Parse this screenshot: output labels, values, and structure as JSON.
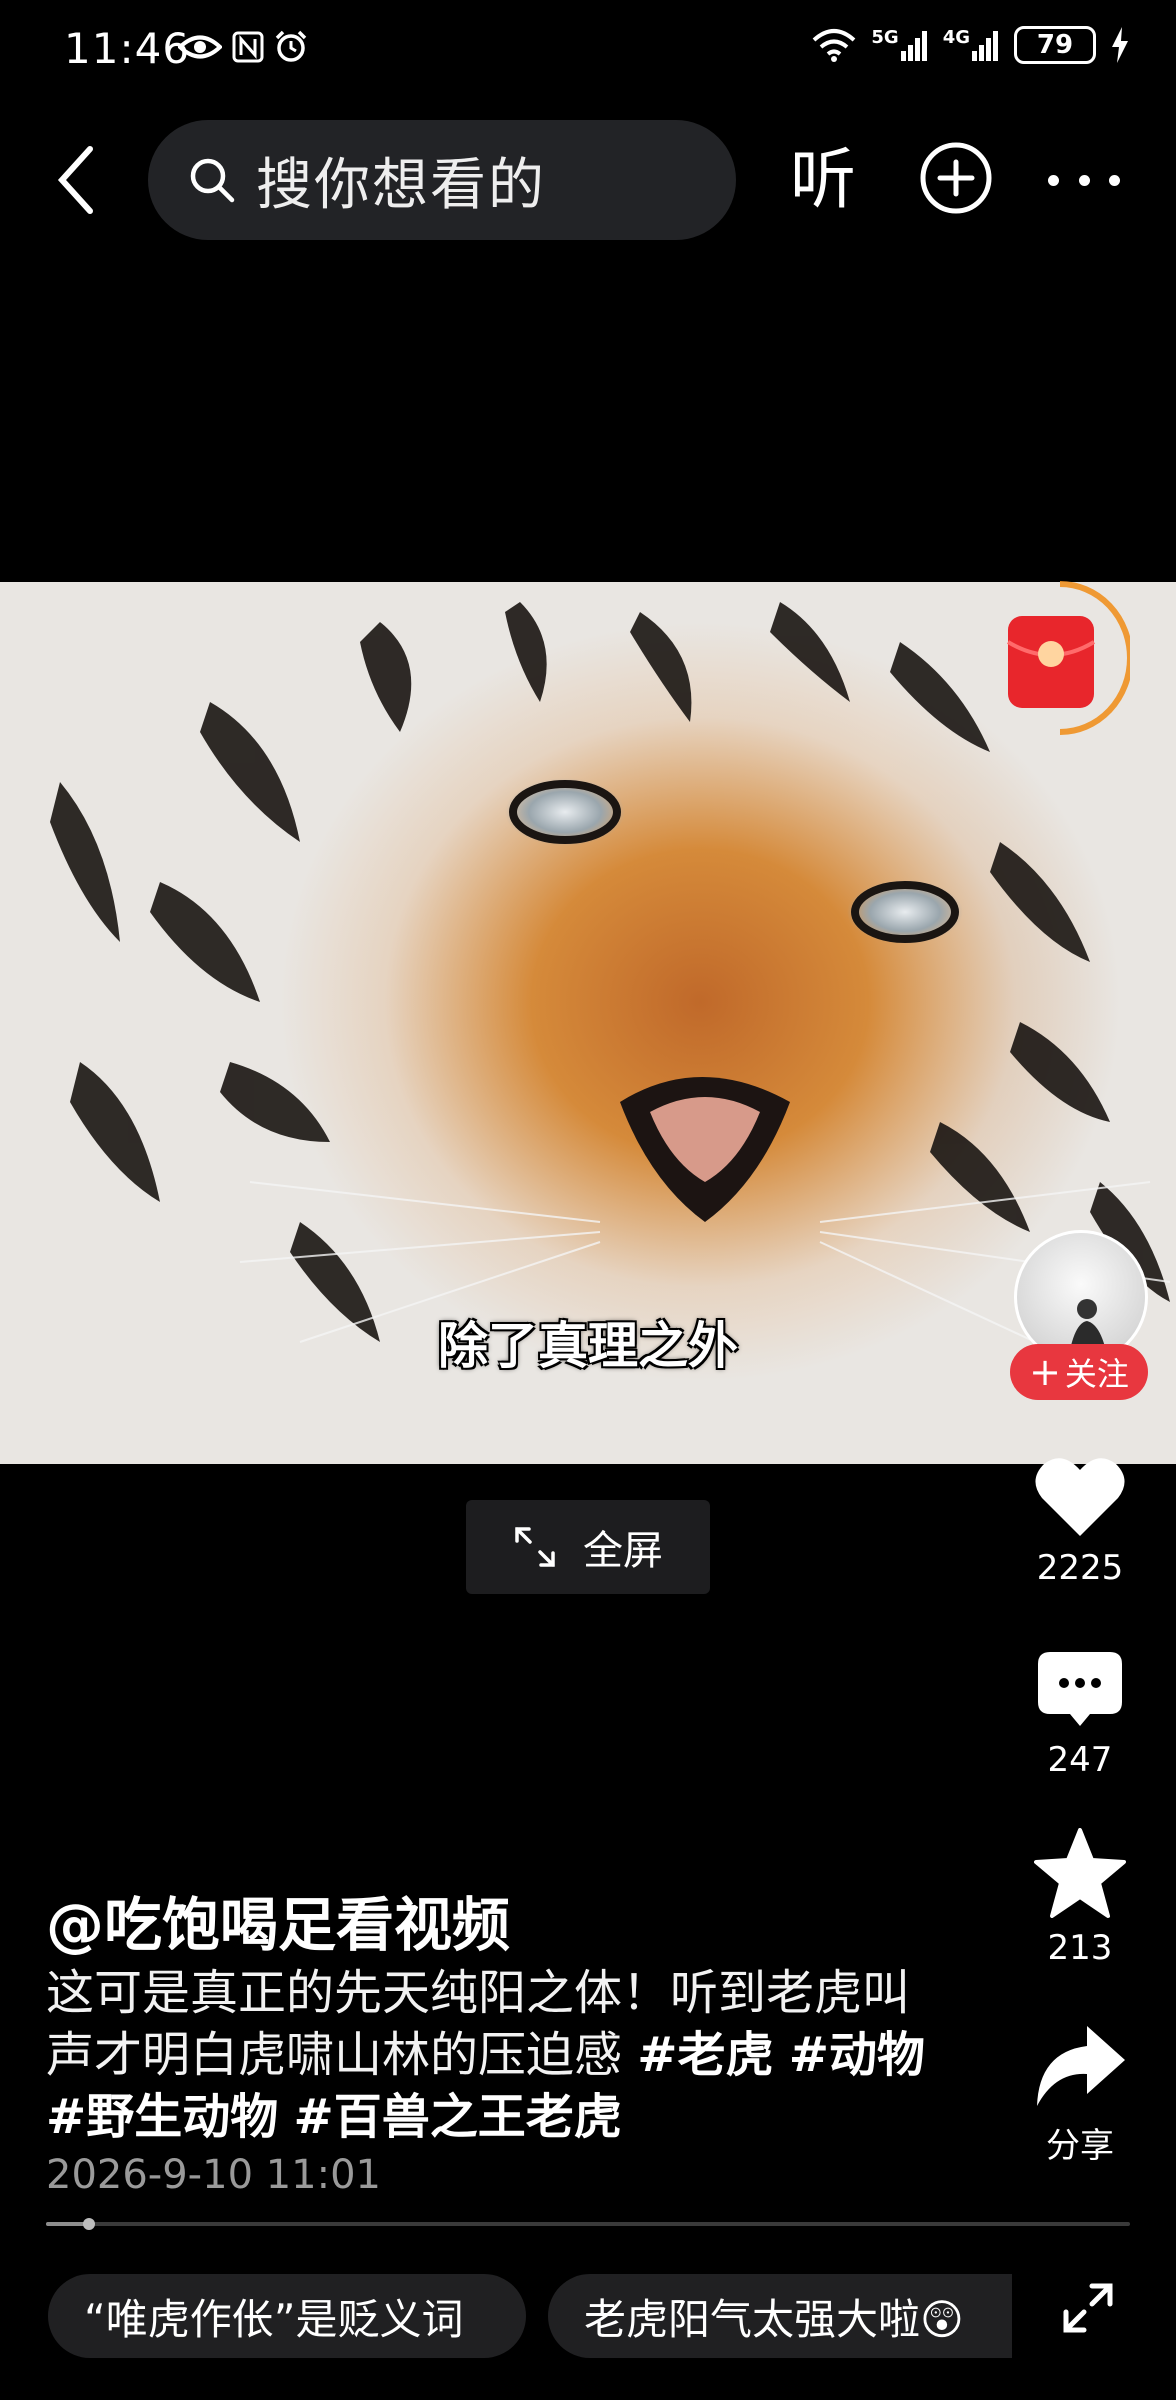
{
  "status_bar": {
    "time": "11:46",
    "icons_left": [
      "eye-icon",
      "nfc-icon",
      "alarm-icon"
    ],
    "icons_right": [
      "wifi-icon",
      "signal-5g-icon",
      "signal-4g-icon",
      "battery-icon",
      "charging-icon"
    ],
    "net1": "5G",
    "net2": "4G",
    "battery": "79"
  },
  "top_bar": {
    "search_placeholder": "搜你想看的",
    "listen_label": "听"
  },
  "video": {
    "subtitle": "除了真理之外",
    "fullscreen_label": "全屏"
  },
  "right_rail": {
    "follow_label": "关注",
    "like_count": "2225",
    "comment_count": "247",
    "favorite_count": "213",
    "share_label": "分享"
  },
  "post": {
    "author": "@吃饱喝足看视频",
    "text": "这可是真正的先天纯阳之体！听到老虎叫声才明白虎啸山林的压迫感 ",
    "tags": [
      "#老虎",
      "#动物",
      "#野生动物",
      "#百兽之王老虎"
    ],
    "timestamp": "2026-9-10 11:01",
    "progress": 0.04
  },
  "suggestion_chips": [
    "“唯虎作伥”是贬义词",
    "老虎阳气太强大啦😲"
  ],
  "colors": {
    "background": "#000000",
    "follow_button": "#e8373f",
    "chip_background": "#202022",
    "search_background": "#222326"
  }
}
